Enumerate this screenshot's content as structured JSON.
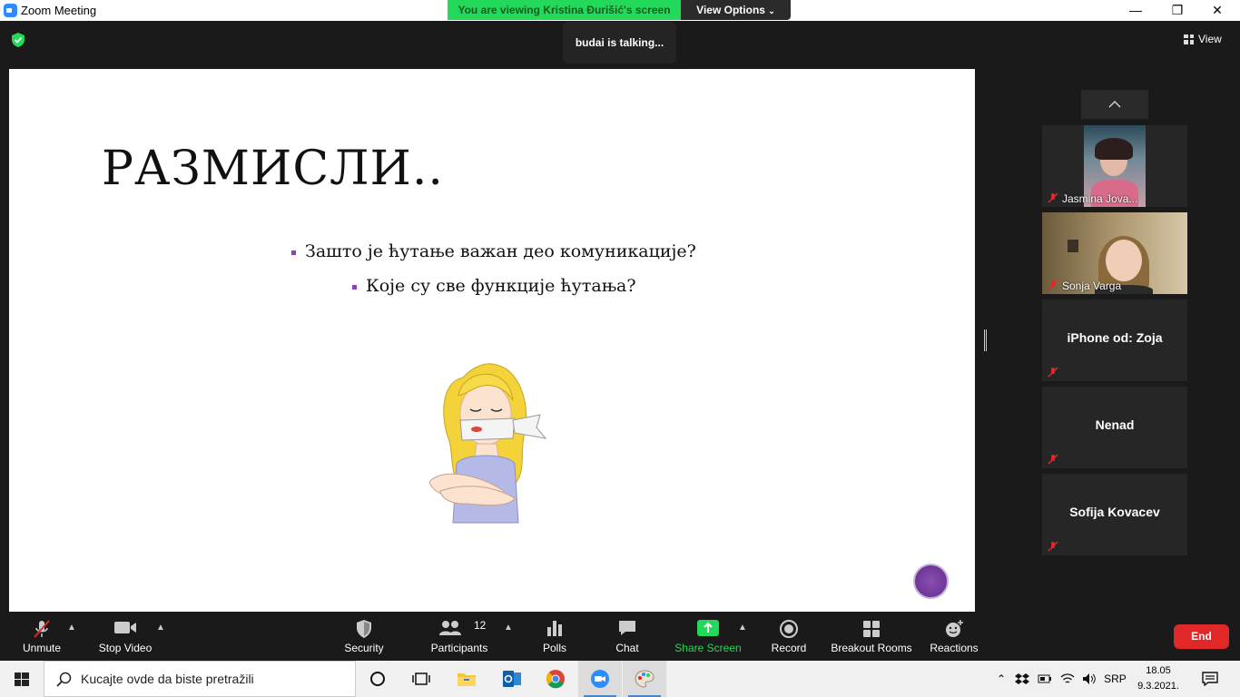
{
  "window": {
    "title": "Zoom Meeting",
    "minimize": "—",
    "maximize": "❐",
    "close": "✕"
  },
  "banner": {
    "viewing": "You are viewing Kristina Đurišić's screen",
    "view_options": "View Options"
  },
  "meeting": {
    "talking": "budai is talking...",
    "view_label": "View"
  },
  "slide": {
    "title": "РАЗМИСЛИ..",
    "bullets": [
      "Зашто је ћутање важан део комуникације?",
      "Које су све функције ћутања?"
    ],
    "accent_color": "#8e44ad"
  },
  "participants": [
    {
      "name": "Jasmina Jova...",
      "type": "video",
      "muted": true
    },
    {
      "name": "Sonja Varga",
      "type": "video",
      "muted": true
    },
    {
      "name": "iPhone od: Zoja",
      "type": "name",
      "muted": true
    },
    {
      "name": "Nenad",
      "type": "name",
      "muted": true
    },
    {
      "name": "Sofija Kovacev",
      "type": "name",
      "muted": true
    }
  ],
  "toolbar": {
    "unmute": "Unmute",
    "stop_video": "Stop Video",
    "security": "Security",
    "participants": "Participants",
    "participants_count": "12",
    "polls": "Polls",
    "chat": "Chat",
    "share_screen": "Share Screen",
    "record": "Record",
    "breakout_rooms": "Breakout Rooms",
    "reactions": "Reactions",
    "end": "End",
    "share_color": "#23d959",
    "end_color": "#e02828"
  },
  "taskbar": {
    "search_placeholder": "Kucajte ovde da biste pretražili",
    "language": "SRP",
    "time": "18.05",
    "date": "9.3.2021."
  }
}
